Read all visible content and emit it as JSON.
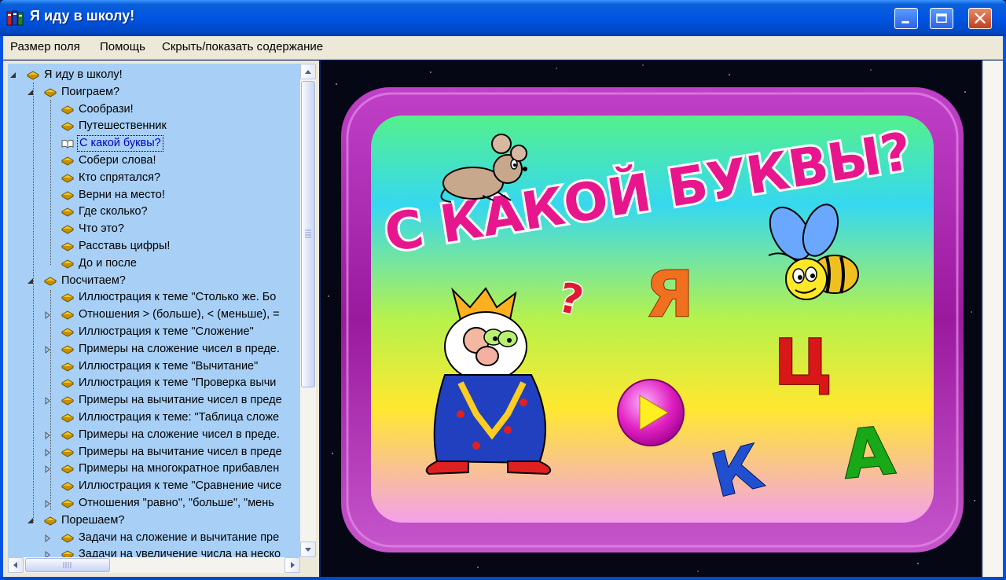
{
  "window": {
    "title": "Я иду в школу!",
    "controls": [
      "minimize-icon",
      "maximize-icon",
      "close-icon"
    ]
  },
  "menu": {
    "items": [
      "Размер поля",
      "Помощь",
      "Скрыть/показать содержание"
    ]
  },
  "tree": {
    "items": [
      {
        "label": "Я иду в школу!",
        "level": 0,
        "expander": "expanded"
      },
      {
        "label": "Поиграем?",
        "level": 1,
        "expander": "expanded"
      },
      {
        "label": "Сообрази!",
        "level": 2,
        "expander": "none"
      },
      {
        "label": "Путешественник",
        "level": 2,
        "expander": "none"
      },
      {
        "label": "С какой буквы?",
        "level": 2,
        "expander": "none",
        "selected": true
      },
      {
        "label": "Собери слова!",
        "level": 2,
        "expander": "none"
      },
      {
        "label": "Кто спрятался?",
        "level": 2,
        "expander": "none"
      },
      {
        "label": "Верни на место!",
        "level": 2,
        "expander": "none"
      },
      {
        "label": "Где сколько?",
        "level": 2,
        "expander": "none"
      },
      {
        "label": "Что это?",
        "level": 2,
        "expander": "none"
      },
      {
        "label": "Расставь цифры!",
        "level": 2,
        "expander": "none"
      },
      {
        "label": "До и после",
        "level": 2,
        "expander": "none"
      },
      {
        "label": "Посчитаем?",
        "level": 1,
        "expander": "expanded"
      },
      {
        "label": "Иллюстрация к теме \"Столько же. Бо",
        "level": 2,
        "expander": "none"
      },
      {
        "label": "Отношения > (больше), < (меньше), =",
        "level": 2,
        "expander": "collapsed"
      },
      {
        "label": "Иллюстрация к теме \"Сложение\"",
        "level": 2,
        "expander": "none"
      },
      {
        "label": "Примеры на сложение чисел в преде.",
        "level": 2,
        "expander": "collapsed"
      },
      {
        "label": "Иллюстрация к теме \"Вычитание\"",
        "level": 2,
        "expander": "none"
      },
      {
        "label": "Иллюстрация к теме \"Проверка вычи",
        "level": 2,
        "expander": "none"
      },
      {
        "label": "Примеры на вычитание чисел в преде",
        "level": 2,
        "expander": "collapsed"
      },
      {
        "label": "Иллюстрация к теме: \"Таблица сложе",
        "level": 2,
        "expander": "none"
      },
      {
        "label": "Примеры на сложение чисел в преде.",
        "level": 2,
        "expander": "collapsed"
      },
      {
        "label": "Примеры на вычитание чисел в преде",
        "level": 2,
        "expander": "collapsed"
      },
      {
        "label": "Примеры на многократное прибавлен",
        "level": 2,
        "expander": "collapsed"
      },
      {
        "label": "Иллюстрация к теме \"Сравнение чисе",
        "level": 2,
        "expander": "none"
      },
      {
        "label": "Отношения \"равно\", \"больше\", \"мень",
        "level": 2,
        "expander": "collapsed"
      },
      {
        "label": "Порешаем?",
        "level": 1,
        "expander": "expanded"
      },
      {
        "label": "Задачи на сложение и вычитание пре",
        "level": 2,
        "expander": "collapsed"
      },
      {
        "label": "Задачи на увеличение числа на неско",
        "level": 2,
        "expander": "collapsed"
      }
    ]
  },
  "game": {
    "title": "С КАКОЙ БУКВЫ?",
    "letters": [
      "Я",
      "Ц",
      "К",
      "А"
    ],
    "question_mark": "?",
    "play_button": "play-icon",
    "colors": {
      "frame": "#a0179e",
      "title": "#e8168c",
      "letter_ya": "#f07020",
      "letter_ts": "#d81818",
      "letter_k": "#2050d0",
      "letter_a": "#18a818",
      "play": "#e020b0"
    }
  }
}
